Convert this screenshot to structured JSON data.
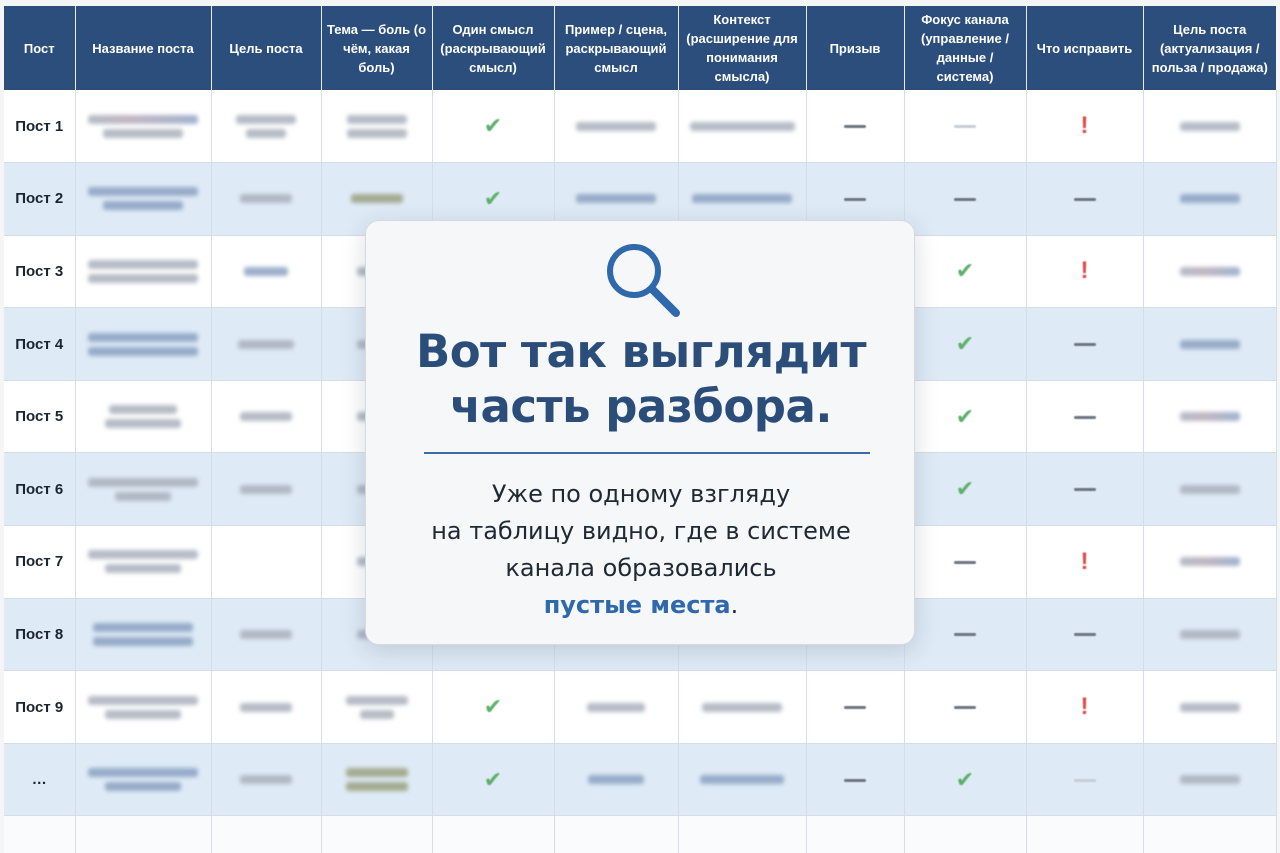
{
  "table": {
    "headers": [
      "Пост",
      "Название поста",
      "Цель поста",
      "Тема — боль (о чём, какая боль)",
      "Один смысл (раскрывающий смысл)",
      "Пример / сцена, раскрывающий смысл",
      "Контекст (расширение для понимания смысла)",
      "Призыв",
      "Фокус канала (управление / данные / система)",
      "Что исправить",
      "Цель поста (актуализация / польза / продажа)"
    ],
    "rows": [
      {
        "label": "Пост 1",
        "status": [
          "check",
          "dash",
          "faint",
          "alert"
        ]
      },
      {
        "label": "Пост 2",
        "status": [
          "check",
          "dash",
          "dash",
          "dash"
        ]
      },
      {
        "label": "Пост 3",
        "status": [
          "",
          "",
          "check",
          "alert"
        ]
      },
      {
        "label": "Пост 4",
        "status": [
          "",
          "",
          "check",
          "dash"
        ]
      },
      {
        "label": "Пост 5",
        "status": [
          "",
          "",
          "check",
          "dash"
        ]
      },
      {
        "label": "Пост 6",
        "status": [
          "",
          "",
          "check",
          "dash"
        ]
      },
      {
        "label": "Пост 7",
        "status": [
          "",
          "",
          "dash",
          "alert"
        ]
      },
      {
        "label": "Пост 8",
        "status": [
          "",
          "",
          "dash",
          "dash"
        ]
      },
      {
        "label": "Пост 9",
        "status": [
          "check",
          "dash",
          "dash",
          "alert"
        ]
      },
      {
        "label": "…",
        "status": [
          "check",
          "dash",
          "check",
          "faint"
        ]
      }
    ]
  },
  "overlay": {
    "icon": "magnifier-icon",
    "title_line1": "Вот так выглядит",
    "title_line2": "часть разбора.",
    "text_line1": "Уже по одному взгляду",
    "text_line2": "на таблицу видно, где в системе",
    "text_line3": "канала образовались",
    "text_highlight": "пустые места",
    "text_end": "."
  },
  "colors": {
    "header_bg": "#2b4e7c",
    "row_alt": "#deeaf5",
    "check": "#5db06c",
    "alert": "#e04b45",
    "title": "#2b4d79",
    "highlight": "#2f69ab"
  }
}
